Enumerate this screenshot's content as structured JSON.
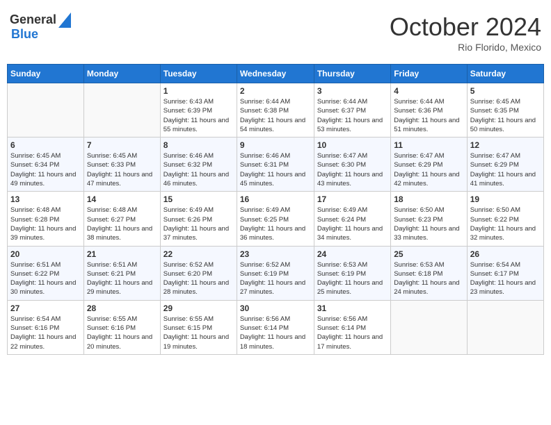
{
  "header": {
    "logo_general": "General",
    "logo_blue": "Blue",
    "month_title": "October 2024",
    "location": "Rio Florido, Mexico"
  },
  "weekdays": [
    "Sunday",
    "Monday",
    "Tuesday",
    "Wednesday",
    "Thursday",
    "Friday",
    "Saturday"
  ],
  "weeks": [
    [
      {
        "day": "",
        "info": ""
      },
      {
        "day": "",
        "info": ""
      },
      {
        "day": "1",
        "info": "Sunrise: 6:43 AM\nSunset: 6:39 PM\nDaylight: 11 hours and 55 minutes."
      },
      {
        "day": "2",
        "info": "Sunrise: 6:44 AM\nSunset: 6:38 PM\nDaylight: 11 hours and 54 minutes."
      },
      {
        "day": "3",
        "info": "Sunrise: 6:44 AM\nSunset: 6:37 PM\nDaylight: 11 hours and 53 minutes."
      },
      {
        "day": "4",
        "info": "Sunrise: 6:44 AM\nSunset: 6:36 PM\nDaylight: 11 hours and 51 minutes."
      },
      {
        "day": "5",
        "info": "Sunrise: 6:45 AM\nSunset: 6:35 PM\nDaylight: 11 hours and 50 minutes."
      }
    ],
    [
      {
        "day": "6",
        "info": "Sunrise: 6:45 AM\nSunset: 6:34 PM\nDaylight: 11 hours and 49 minutes."
      },
      {
        "day": "7",
        "info": "Sunrise: 6:45 AM\nSunset: 6:33 PM\nDaylight: 11 hours and 47 minutes."
      },
      {
        "day": "8",
        "info": "Sunrise: 6:46 AM\nSunset: 6:32 PM\nDaylight: 11 hours and 46 minutes."
      },
      {
        "day": "9",
        "info": "Sunrise: 6:46 AM\nSunset: 6:31 PM\nDaylight: 11 hours and 45 minutes."
      },
      {
        "day": "10",
        "info": "Sunrise: 6:47 AM\nSunset: 6:30 PM\nDaylight: 11 hours and 43 minutes."
      },
      {
        "day": "11",
        "info": "Sunrise: 6:47 AM\nSunset: 6:29 PM\nDaylight: 11 hours and 42 minutes."
      },
      {
        "day": "12",
        "info": "Sunrise: 6:47 AM\nSunset: 6:29 PM\nDaylight: 11 hours and 41 minutes."
      }
    ],
    [
      {
        "day": "13",
        "info": "Sunrise: 6:48 AM\nSunset: 6:28 PM\nDaylight: 11 hours and 39 minutes."
      },
      {
        "day": "14",
        "info": "Sunrise: 6:48 AM\nSunset: 6:27 PM\nDaylight: 11 hours and 38 minutes."
      },
      {
        "day": "15",
        "info": "Sunrise: 6:49 AM\nSunset: 6:26 PM\nDaylight: 11 hours and 37 minutes."
      },
      {
        "day": "16",
        "info": "Sunrise: 6:49 AM\nSunset: 6:25 PM\nDaylight: 11 hours and 36 minutes."
      },
      {
        "day": "17",
        "info": "Sunrise: 6:49 AM\nSunset: 6:24 PM\nDaylight: 11 hours and 34 minutes."
      },
      {
        "day": "18",
        "info": "Sunrise: 6:50 AM\nSunset: 6:23 PM\nDaylight: 11 hours and 33 minutes."
      },
      {
        "day": "19",
        "info": "Sunrise: 6:50 AM\nSunset: 6:22 PM\nDaylight: 11 hours and 32 minutes."
      }
    ],
    [
      {
        "day": "20",
        "info": "Sunrise: 6:51 AM\nSunset: 6:22 PM\nDaylight: 11 hours and 30 minutes."
      },
      {
        "day": "21",
        "info": "Sunrise: 6:51 AM\nSunset: 6:21 PM\nDaylight: 11 hours and 29 minutes."
      },
      {
        "day": "22",
        "info": "Sunrise: 6:52 AM\nSunset: 6:20 PM\nDaylight: 11 hours and 28 minutes."
      },
      {
        "day": "23",
        "info": "Sunrise: 6:52 AM\nSunset: 6:19 PM\nDaylight: 11 hours and 27 minutes."
      },
      {
        "day": "24",
        "info": "Sunrise: 6:53 AM\nSunset: 6:19 PM\nDaylight: 11 hours and 25 minutes."
      },
      {
        "day": "25",
        "info": "Sunrise: 6:53 AM\nSunset: 6:18 PM\nDaylight: 11 hours and 24 minutes."
      },
      {
        "day": "26",
        "info": "Sunrise: 6:54 AM\nSunset: 6:17 PM\nDaylight: 11 hours and 23 minutes."
      }
    ],
    [
      {
        "day": "27",
        "info": "Sunrise: 6:54 AM\nSunset: 6:16 PM\nDaylight: 11 hours and 22 minutes."
      },
      {
        "day": "28",
        "info": "Sunrise: 6:55 AM\nSunset: 6:16 PM\nDaylight: 11 hours and 20 minutes."
      },
      {
        "day": "29",
        "info": "Sunrise: 6:55 AM\nSunset: 6:15 PM\nDaylight: 11 hours and 19 minutes."
      },
      {
        "day": "30",
        "info": "Sunrise: 6:56 AM\nSunset: 6:14 PM\nDaylight: 11 hours and 18 minutes."
      },
      {
        "day": "31",
        "info": "Sunrise: 6:56 AM\nSunset: 6:14 PM\nDaylight: 11 hours and 17 minutes."
      },
      {
        "day": "",
        "info": ""
      },
      {
        "day": "",
        "info": ""
      }
    ]
  ]
}
